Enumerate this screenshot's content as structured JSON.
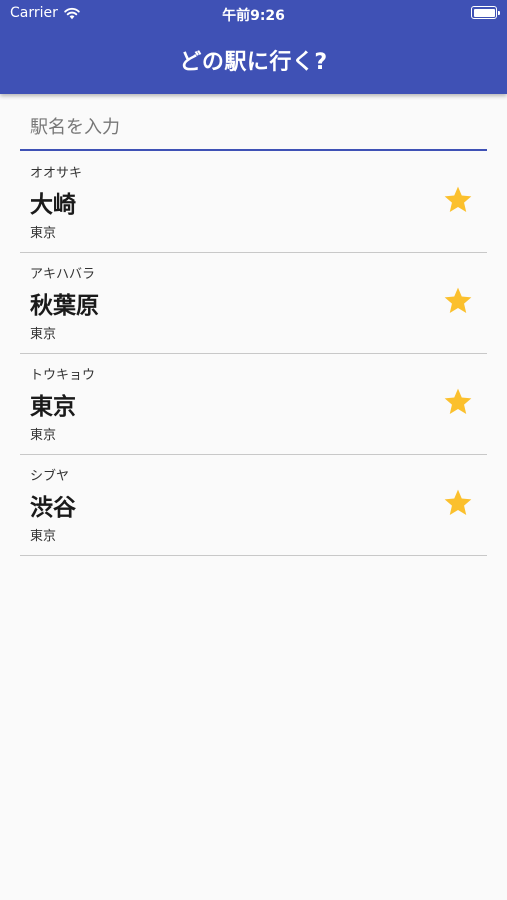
{
  "status_bar": {
    "carrier": "Carrier",
    "time": "午前9:26"
  },
  "app_bar": {
    "title": "どの駅に行く?"
  },
  "search": {
    "placeholder": "駅名を入力",
    "value": ""
  },
  "stations": [
    {
      "kana": "オオサキ",
      "name": "大崎",
      "prefecture": "東京",
      "favorite": true
    },
    {
      "kana": "アキハバラ",
      "name": "秋葉原",
      "prefecture": "東京",
      "favorite": true
    },
    {
      "kana": "トウキョウ",
      "name": "東京",
      "prefecture": "東京",
      "favorite": true
    },
    {
      "kana": "シブヤ",
      "name": "渋谷",
      "prefecture": "東京",
      "favorite": true
    }
  ],
  "colors": {
    "primary": "#3f51b5",
    "star": "#fbc02d",
    "background": "#fafafa",
    "divider": "#c8c8c8"
  },
  "icons": {
    "favorite": "star-icon",
    "wifi": "wifi-icon",
    "battery": "battery-icon"
  }
}
